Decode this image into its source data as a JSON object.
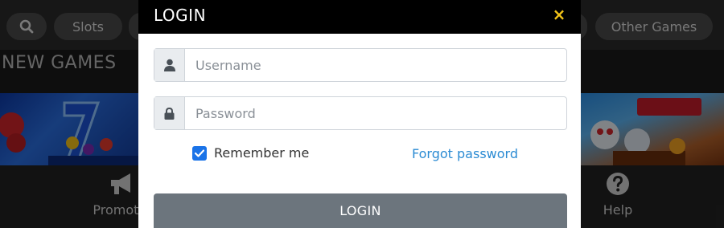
{
  "background": {
    "nav": {
      "slots_label": "Slots",
      "other_games_label": "Other Games"
    },
    "section_title": "NEW GAMES",
    "bottom_nav": {
      "promotions_label": "Promotio",
      "help_label": "Help"
    }
  },
  "modal": {
    "title": "LOGIN",
    "close_icon": "×",
    "username": {
      "placeholder": "Username",
      "icon": "user-icon"
    },
    "password": {
      "placeholder": "Password",
      "icon": "lock-icon"
    },
    "remember_label": "Remember me",
    "remember_checked": true,
    "forgot_label": "Forgot password",
    "submit_label": "LOGIN"
  },
  "colors": {
    "accent_close": "#f2c318",
    "link": "#2b8bd3",
    "checkbox": "#1a73e8",
    "button": "#6c757d"
  }
}
